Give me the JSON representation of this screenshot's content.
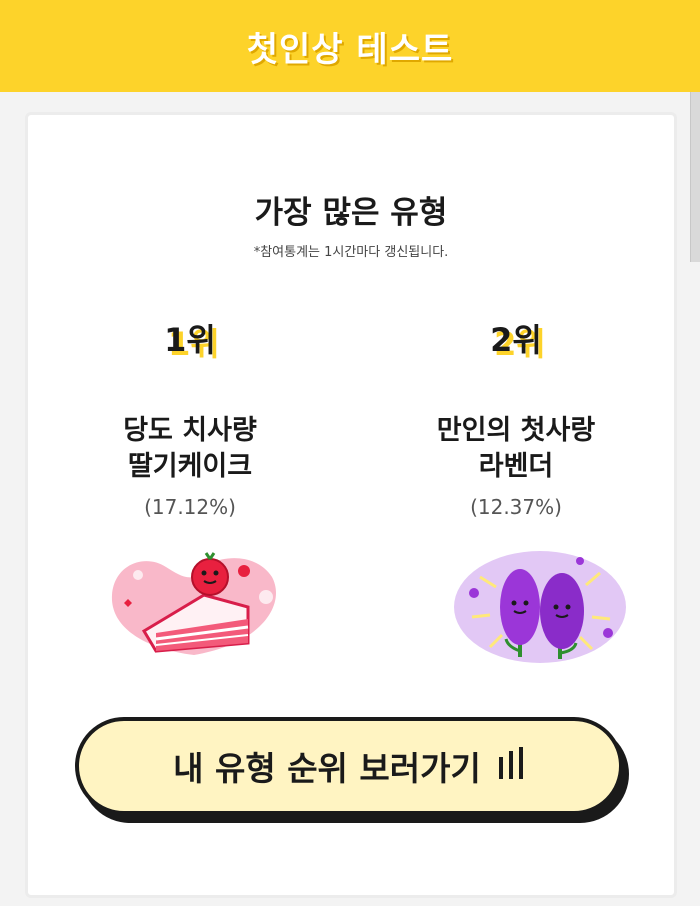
{
  "header": {
    "title": "첫인상 테스트"
  },
  "stats": {
    "title": "가장 많은 유형",
    "note": "*참여통계는 1시간마다 갱신됩니다."
  },
  "ranks": [
    {
      "rank": "1위",
      "name_line1": "당도 치사량",
      "name_line2": "딸기케이크",
      "percent": "(17.12%)",
      "icon": "strawberry-cake-illustration"
    },
    {
      "rank": "2위",
      "name_line1": "만인의 첫사랑",
      "name_line2": "라벤더",
      "percent": "(12.37%)",
      "icon": "lavender-illustration"
    }
  ],
  "cta": {
    "label": "내 유형 순위 보러가기",
    "icon": "bars-icon"
  },
  "colors": {
    "brand": "#fdd32a",
    "cta_bg": "#fff4c2",
    "text": "#1a1a1a"
  }
}
